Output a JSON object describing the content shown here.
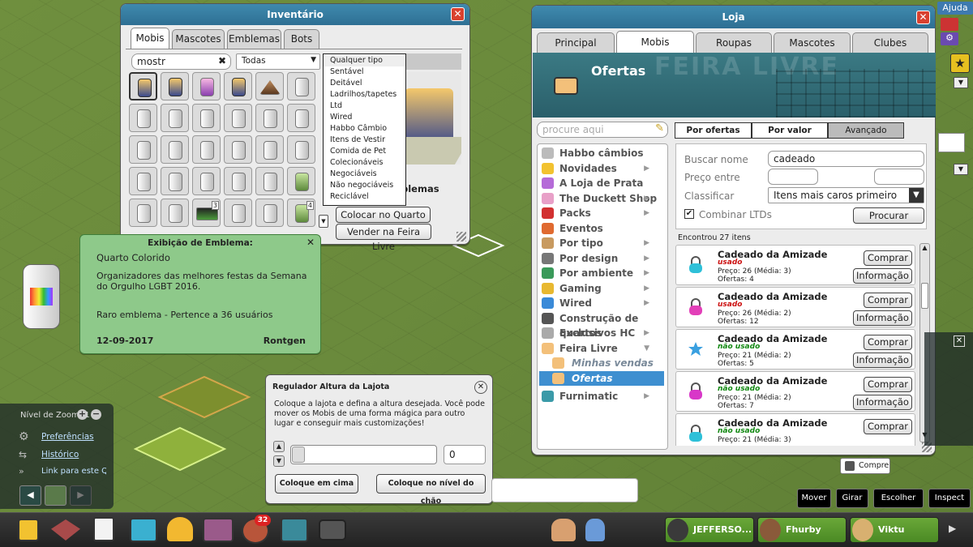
{
  "inventory": {
    "title": "Inventário",
    "tabs": [
      "Mobis",
      "Mascotes",
      "Emblemas",
      "Bots"
    ],
    "search_value": "mostr",
    "filter_value": "Todas",
    "filter_options": [
      "Qualquer tipo",
      "Sentável",
      "Deitável",
      "Ladrilhos/tapetes",
      "Ltd",
      "Wired",
      "Habbo Câmbio",
      "Itens de Vestir",
      "Comida de Pet",
      "Colecionáveis",
      "Negociáveis",
      "Não negociáveis",
      "Reciclável"
    ],
    "preview_label": "blemas",
    "place_button": "Colocar no Quarto",
    "sell_button": "Vender na Feira Livre",
    "counts": [
      "3",
      "4"
    ]
  },
  "badge_popup": {
    "title": "Exibição de Emblema:",
    "name": "Quarto Colorido",
    "description": "Organizadores das melhores festas da Semana do Orgulho LGBT 2016.",
    "rarity": "Raro emblema - Pertence a 36 usuários",
    "date": "12-09-2017",
    "user": "Rontgen"
  },
  "shop": {
    "title": "Loja",
    "tabs": [
      "Principal",
      "Mobis",
      "Roupas",
      "Mascotes",
      "Clubes"
    ],
    "banner_title": "Ofertas",
    "banner_bg_text": "FEIRA LIVRE",
    "search_placeholder": "procure aqui",
    "categories": [
      {
        "label": "Habbo câmbios",
        "arrow": false
      },
      {
        "label": "Novidades",
        "arrow": true
      },
      {
        "label": "A Loja de Prata",
        "arrow": false
      },
      {
        "label": "The Duckett Shop",
        "arrow": true
      },
      {
        "label": "Packs",
        "arrow": true
      },
      {
        "label": "Eventos",
        "arrow": false
      },
      {
        "label": "Por tipo",
        "arrow": true
      },
      {
        "label": "Por design",
        "arrow": true
      },
      {
        "label": "Por ambiente",
        "arrow": true
      },
      {
        "label": "Gaming",
        "arrow": true
      },
      {
        "label": "Wired",
        "arrow": true
      },
      {
        "label": "Construção de quartos",
        "arrow": false
      },
      {
        "label": "Exclusivos HC",
        "arrow": true
      },
      {
        "label": "Feira Livre",
        "arrow": true
      }
    ],
    "sub_categories": [
      "Minhas vendas",
      "Ofertas"
    ],
    "last_category": "Furnimatic",
    "sort_tabs": [
      "Por ofertas",
      "Por valor",
      "Avançado"
    ],
    "form": {
      "name_label": "Buscar nome",
      "name_value": "cadeado",
      "price_label": "Preço entre",
      "sort_label": "Classificar",
      "sort_value": "Itens mais caros primeiro",
      "ltd_label": "Combinar LTDs",
      "search_button": "Procurar"
    },
    "results_label": "Encontrou 27 itens",
    "items": [
      {
        "name": "Cadeado da Amizade",
        "status": "usado",
        "price": "Preço: 26 (Média: 3)",
        "offers": "Ofertas: 4",
        "color": "#2ec0d8"
      },
      {
        "name": "Cadeado da Amizade",
        "status": "usado",
        "price": "Preço: 26 (Média: 2)",
        "offers": "Ofertas: 12",
        "color": "#e23fb8"
      },
      {
        "name": "Cadeado da Amizade",
        "status": "não usado",
        "price": "Preço: 21 (Média: 2)",
        "offers": "Ofertas: 5",
        "color": "#3aa0e0"
      },
      {
        "name": "Cadeado da Amizade",
        "status": "não usado",
        "price": "Preço: 21 (Média: 2)",
        "offers": "Ofertas: 7",
        "color": "#d838c8"
      },
      {
        "name": "Cadeado da Amizade",
        "status": "não usado",
        "price": "Preço: 21 (Média: 3)",
        "offers": "",
        "color": "#2ec0d8"
      }
    ],
    "buy_button": "Comprar",
    "info_button": "Informação",
    "status_colors": {
      "usado": "#cc1111",
      "não usado": "#118811"
    }
  },
  "height_tool": {
    "title": "Regulador Altura da Lajota",
    "text": "Coloque a lajota e defina a altura desejada. Você pode mover os Mobis de uma forma mágica para outro lugar e conseguir mais customizações!",
    "value": "0",
    "btn_top": "Coloque em cima",
    "btn_floor": "Coloque no nível do chão"
  },
  "zoom_panel": {
    "zoom_label": "Nível de Zoom: 1",
    "links": [
      "Preferências",
      "Histórico",
      "Link para este Qu"
    ]
  },
  "right_panel": {
    "help": "Ajuda",
    "buy_label": "Compre",
    "actions": [
      "Mover",
      "Girar",
      "Escolher",
      "Inspect"
    ]
  },
  "toolbar": {
    "badge_count": "32",
    "friends": [
      "JEFFERSO...",
      "Fhurby",
      "Viktu"
    ]
  }
}
